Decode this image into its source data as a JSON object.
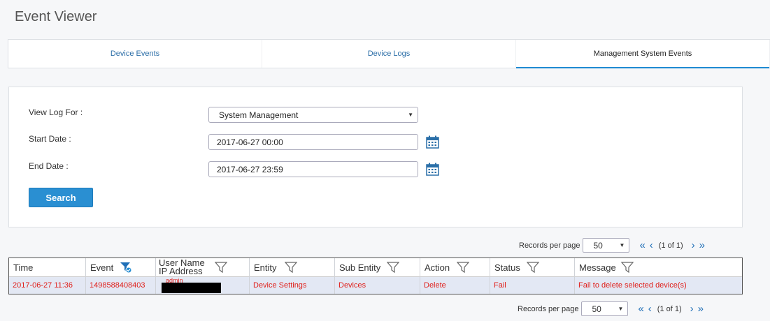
{
  "page": {
    "title": "Event Viewer"
  },
  "tabs": [
    {
      "label": "Device Events"
    },
    {
      "label": "Device Logs"
    },
    {
      "label": "Management System Events"
    }
  ],
  "filters": {
    "view_log_for_label": "View Log For :",
    "view_log_for_value": "System Management",
    "start_date_label": "Start Date :",
    "start_date_value": "2017-06-27 00:00",
    "end_date_label": "End Date :",
    "end_date_value": "2017-06-27 23:59",
    "search_label": "Search"
  },
  "pager": {
    "records_per_page_label": "Records per page",
    "records_per_page_value": "50",
    "first_label": "«",
    "prev_label": "‹",
    "next_label": "›",
    "last_label": "»",
    "page_info": "(1 of 1)"
  },
  "table": {
    "columns": [
      "Time",
      "Event",
      "User Name",
      "IP Address",
      "Entity",
      "Sub Entity",
      "Action",
      "Status",
      "Message"
    ],
    "rows": [
      {
        "time": "2017-06-27 11:36",
        "event": "1498588408403",
        "user": "admin",
        "entity": "Device Settings",
        "sub_entity": "Devices",
        "action": "Delete",
        "status": "Fail",
        "message": "Fail to delete selected device(s)"
      }
    ]
  },
  "colors": {
    "accent": "#2a8fd2",
    "error": "#e0201b",
    "link": "#2d6fa8"
  },
  "icons": {
    "calendar": "calendar-icon",
    "filter": "filter-icon",
    "filter_active": "filter-active-icon"
  }
}
